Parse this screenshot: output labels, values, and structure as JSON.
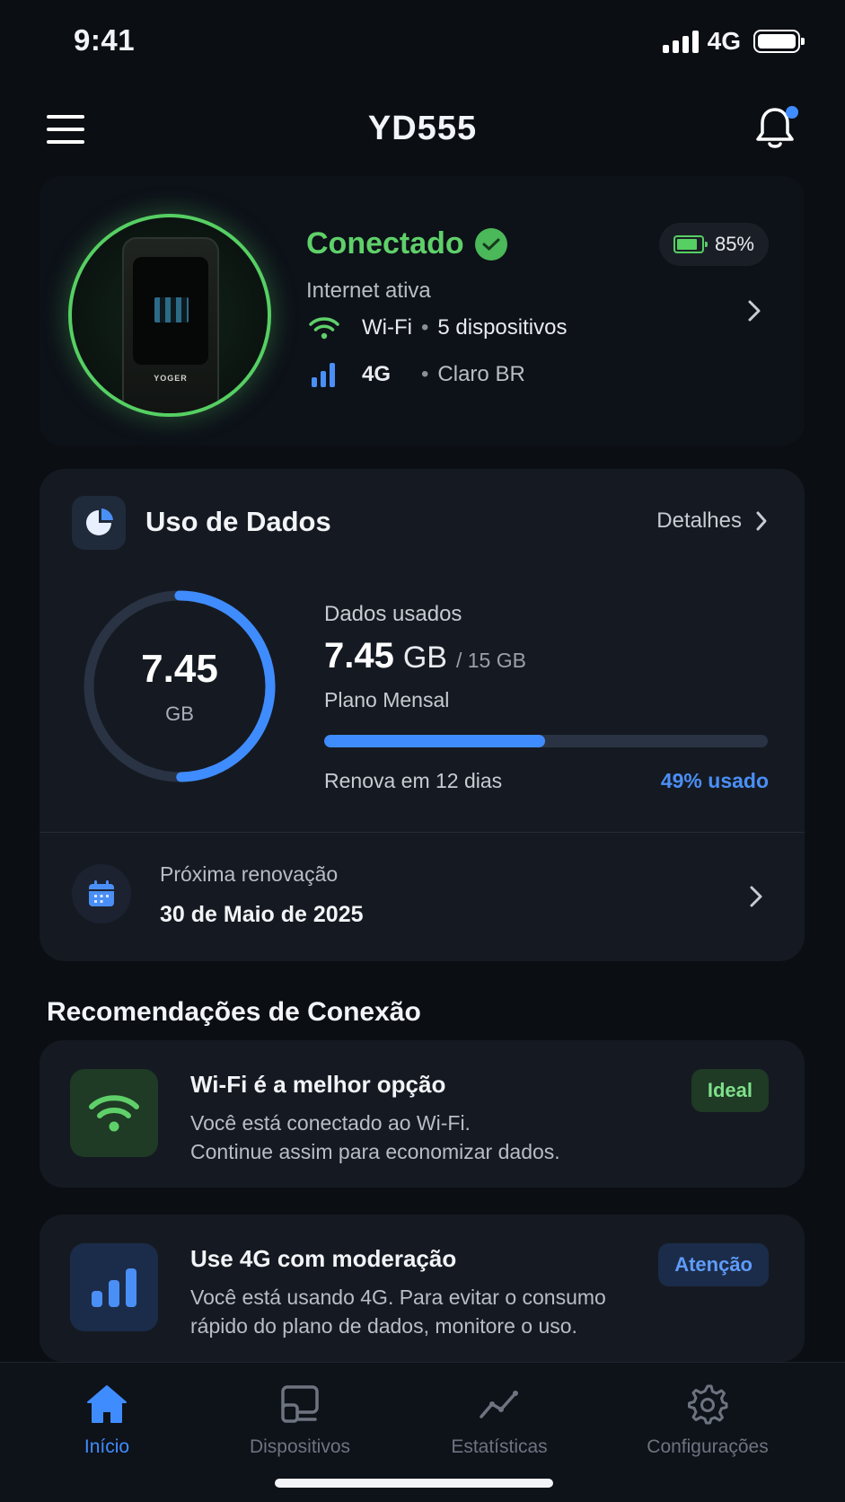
{
  "status_bar": {
    "time": "9:41",
    "network": "4G"
  },
  "header": {
    "title": "YD555"
  },
  "device": {
    "brand_mark": "YOGER",
    "status": "Conectado",
    "subtitle": "Internet ativa",
    "battery": "85%",
    "wifi_label": "Wi-Fi",
    "wifi_devices": "5 dispositivos",
    "cell_label": "4G",
    "carrier": "Claro BR"
  },
  "data_usage": {
    "title": "Uso de Dados",
    "details_label": "Detalhes",
    "gauge_value": "7.45",
    "gauge_unit": "GB",
    "used_label": "Dados usados",
    "used_amount": "7.45",
    "used_unit": "GB",
    "total": "/ 15 GB",
    "plan": "Plano Mensal",
    "renew_days": "Renova em 12 dias",
    "percent_label": "49% usado",
    "percent_used": 0.497,
    "next_renewal_label": "Próxima renovação",
    "next_renewal_date": "30 de Maio de 2025"
  },
  "recommendations": {
    "title": "Recomendações de Conexão",
    "items": [
      {
        "title": "Wi-Fi é a melhor opção",
        "line1": "Você está conectado ao Wi-Fi.",
        "line2": "Continue assim para economizar dados.",
        "badge": "Ideal",
        "icon": "wifi-icon",
        "color": "#5fd069"
      },
      {
        "title": "Use 4G com moderação",
        "line1": "Você está usando 4G. Para evitar o consumo",
        "line2": "rápido do plano de dados, monitore o uso.",
        "badge": "Atenção",
        "icon": "cell-signal-icon",
        "color": "#4a8ff5"
      }
    ]
  },
  "nav": {
    "items": [
      {
        "label": "Início",
        "icon": "home-icon",
        "active": true
      },
      {
        "label": "Dispositivos",
        "icon": "devices-icon",
        "active": false
      },
      {
        "label": "Estatísticas",
        "icon": "stats-icon",
        "active": false
      },
      {
        "label": "Configurações",
        "icon": "gear-icon",
        "active": false
      }
    ]
  },
  "colors": {
    "accent": "#3f8cff",
    "success": "#5fd069",
    "background": "#0b0e13",
    "card": "#151a22"
  }
}
